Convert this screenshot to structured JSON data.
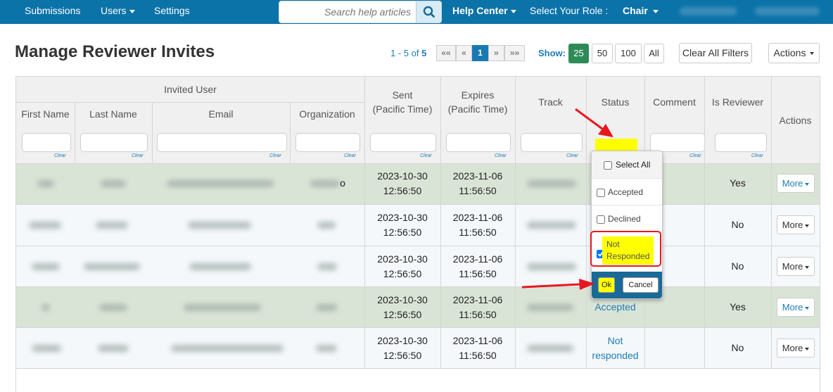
{
  "nav": {
    "submissions": "Submissions",
    "users": "Users",
    "settings": "Settings",
    "search_placeholder": "Search help articles",
    "help_center": "Help Center",
    "role_label": "Select Your Role :",
    "role_value": "Chair"
  },
  "header": {
    "title": "Manage Reviewer Invites",
    "pager_range": "1 - 5 of",
    "pager_total": "5",
    "pages": [
      "««",
      "«",
      "1",
      "»",
      "»»"
    ],
    "show_label": "Show:",
    "show_options": [
      "25",
      "50",
      "100",
      "All"
    ],
    "show_selected": "25",
    "clear_filters": "Clear All Filters",
    "actions": "Actions"
  },
  "table": {
    "group_header": "Invited User",
    "columns": {
      "first_name": "First Name",
      "last_name": "Last Name",
      "email": "Email",
      "organization": "Organization",
      "sent_line1": "Sent",
      "sent_line2": "(Pacific Time)",
      "expires_line1": "Expires",
      "expires_line2": "(Pacific Time)",
      "track": "Track",
      "status": "Status",
      "comment": "Comment",
      "is_reviewer": "Is Reviewer",
      "actions": "Actions"
    },
    "clear_label": "Clear",
    "rows": [
      {
        "sent_date": "2023-10-30",
        "sent_time": "12:56:50",
        "exp_date": "2023-11-06",
        "exp_time": "11:56:50",
        "status": "",
        "is_reviewer": "Yes",
        "action": "More",
        "org_tail": "o"
      },
      {
        "sent_date": "2023-10-30",
        "sent_time": "12:56:50",
        "exp_date": "2023-11-06",
        "exp_time": "11:56:50",
        "status": "",
        "is_reviewer": "No",
        "action": "More"
      },
      {
        "sent_date": "2023-10-30",
        "sent_time": "12:56:50",
        "exp_date": "2023-11-06",
        "exp_time": "11:56:50",
        "status": "",
        "is_reviewer": "No",
        "action": "More"
      },
      {
        "sent_date": "2023-10-30",
        "sent_time": "12:56:50",
        "exp_date": "2023-11-06",
        "exp_time": "11:56:50",
        "status": "Accepted",
        "is_reviewer": "Yes",
        "action": "More"
      },
      {
        "sent_date": "2023-10-30",
        "sent_time": "12:56:50",
        "exp_date": "2023-11-06",
        "exp_time": "11:56:50",
        "status_line1": "Not",
        "status_line2": "responded",
        "is_reviewer": "No",
        "action": "More"
      }
    ]
  },
  "status_filter_popup": {
    "select_all": "Select All",
    "options": [
      {
        "label": "Accepted",
        "checked": false
      },
      {
        "label": "Declined",
        "checked": false
      },
      {
        "label_line1": "Not",
        "label_line2": "Responded",
        "checked": true
      }
    ],
    "ok": "Ok",
    "cancel": "Cancel"
  },
  "colors": {
    "nav_bg": "#0b73a8",
    "accent_blue": "#1f7bb6",
    "row_green": "#dae4d6",
    "row_blue": "#f4f8fb",
    "highlight_yellow": "#ffff00",
    "annotation_red": "#e8171f",
    "show_active": "#2e8b57"
  }
}
